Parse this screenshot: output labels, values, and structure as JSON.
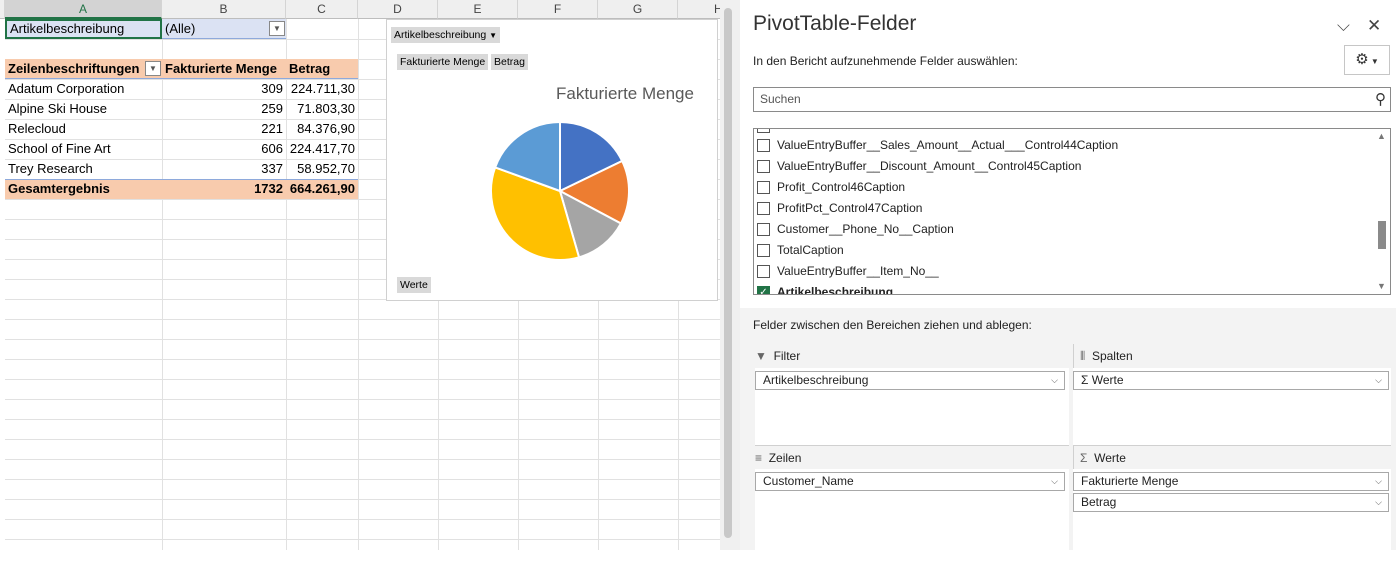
{
  "sheet": {
    "columns": [
      "A",
      "B",
      "C",
      "D",
      "E",
      "F",
      "G",
      "H"
    ],
    "filter": {
      "label": "Artikelbeschreibung",
      "value": "(Alle)"
    },
    "pivot": {
      "headers": [
        "Zeilenbeschriftungen",
        "Fakturierte Menge",
        "Betrag"
      ],
      "rows": [
        {
          "name": "Adatum Corporation",
          "qty": "309",
          "amount": "224.711,30"
        },
        {
          "name": "Alpine Ski House",
          "qty": "259",
          "amount": "71.803,30"
        },
        {
          "name": "Relecloud",
          "qty": "221",
          "amount": "84.376,90"
        },
        {
          "name": "School of Fine Art",
          "qty": "606",
          "amount": "224.417,70"
        },
        {
          "name": "Trey Research",
          "qty": "337",
          "amount": "58.952,70"
        }
      ],
      "total": {
        "name": "Gesamtergebnis",
        "qty": "1732",
        "amount": "664.261,90"
      }
    }
  },
  "chart": {
    "filter_button": "Artikelbeschreibung",
    "value_buttons": [
      "Fakturierte Menge",
      "Betrag"
    ],
    "werte_button": "Werte"
  },
  "chart_data": {
    "type": "pie",
    "title": "Fakturierte Menge",
    "categories": [
      "Adatum Corporation",
      "Alpine Ski House",
      "Relecloud",
      "School of Fine Art",
      "Trey Research"
    ],
    "values": [
      309,
      259,
      221,
      606,
      337
    ],
    "colors": [
      "#4472c4",
      "#ed7d31",
      "#a5a5a5",
      "#ffc000",
      "#5b9bd5"
    ]
  },
  "panel": {
    "title": "PivotTable-Felder",
    "subtitle": "In den Bericht aufzunehmende Felder auswählen:",
    "search_placeholder": "Suchen",
    "fields": [
      {
        "label": "ValueEntryBuffer__Sales_Amount__Actual___Control44Caption",
        "checked": false
      },
      {
        "label": "ValueEntryBuffer__Discount_Amount__Control45Caption",
        "checked": false
      },
      {
        "label": "Profit_Control46Caption",
        "checked": false
      },
      {
        "label": "ProfitPct_Control47Caption",
        "checked": false
      },
      {
        "label": "Customer__Phone_No__Caption",
        "checked": false
      },
      {
        "label": "TotalCaption",
        "checked": false
      },
      {
        "label": "ValueEntryBuffer__Item_No__",
        "checked": false
      },
      {
        "label": "Artikelbeschreibung",
        "checked": true
      }
    ],
    "drag_label": "Felder zwischen den Bereichen ziehen und ablegen:",
    "areas": {
      "filter": {
        "title": "Filter",
        "items": [
          "Artikelbeschreibung"
        ]
      },
      "columns": {
        "title": "Spalten",
        "items": [
          "Werte"
        ]
      },
      "rows": {
        "title": "Zeilen",
        "items": [
          "Customer_Name"
        ]
      },
      "values": {
        "title": "Werte",
        "items": [
          "Fakturierte Menge",
          "Betrag"
        ]
      }
    }
  }
}
